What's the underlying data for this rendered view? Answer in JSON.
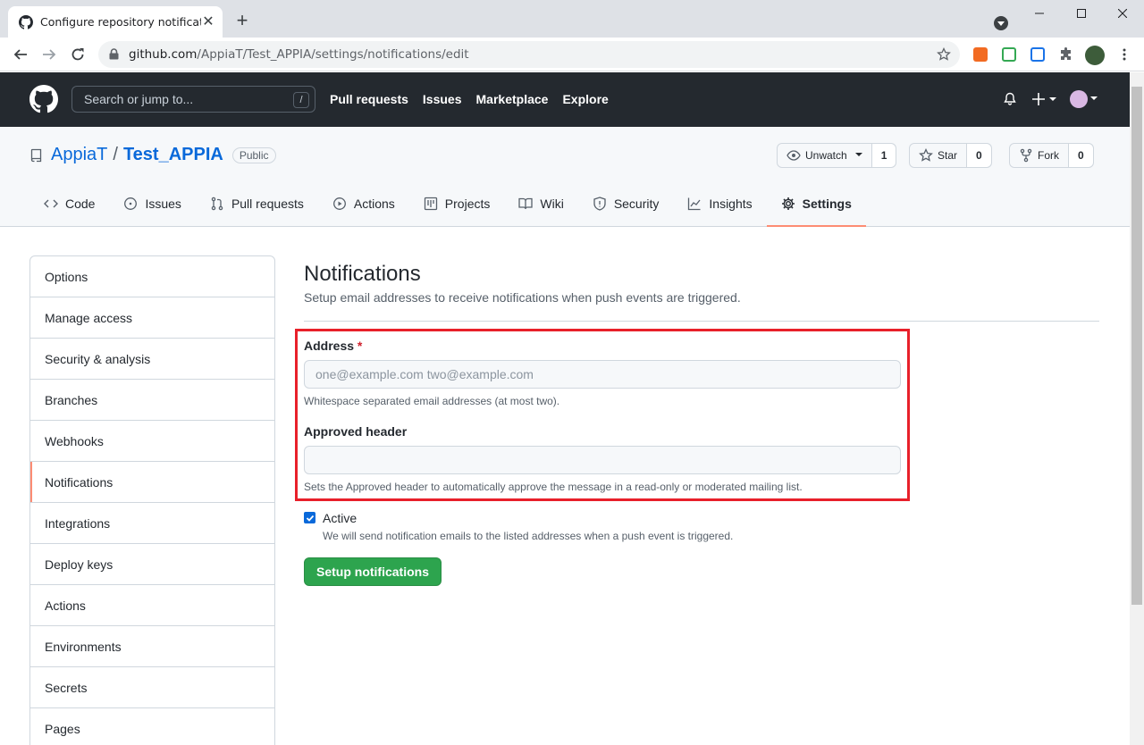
{
  "browser": {
    "tab_title": "Configure repository notification",
    "url_host": "github.com",
    "url_path": "/AppiaT/Test_APPIA/settings/notifications/edit"
  },
  "header": {
    "search_placeholder": "Search or jump to...",
    "search_shortcut": "/",
    "nav": [
      "Pull requests",
      "Issues",
      "Marketplace",
      "Explore"
    ]
  },
  "repo": {
    "owner": "AppiaT",
    "separator": "/",
    "name": "Test_APPIA",
    "visibility": "Public",
    "watch_label": "Unwatch",
    "watch_count": "1",
    "star_label": "Star",
    "star_count": "0",
    "fork_label": "Fork",
    "fork_count": "0",
    "tabs": [
      "Code",
      "Issues",
      "Pull requests",
      "Actions",
      "Projects",
      "Wiki",
      "Security",
      "Insights",
      "Settings"
    ],
    "active_tab": "Settings"
  },
  "sidebar": {
    "items": [
      "Options",
      "Manage access",
      "Security & analysis",
      "Branches",
      "Webhooks",
      "Notifications",
      "Integrations",
      "Deploy keys",
      "Actions",
      "Environments",
      "Secrets",
      "Pages"
    ],
    "active": "Notifications"
  },
  "main": {
    "title": "Notifications",
    "subtitle": "Setup email addresses to receive notifications when push events are triggered.",
    "address_label": "Address",
    "required_mark": "*",
    "address_placeholder": "one@example.com two@example.com",
    "address_note": "Whitespace separated email addresses (at most two).",
    "approved_label": "Approved header",
    "approved_value": "",
    "approved_note": "Sets the Approved header to automatically approve the message in a read-only or moderated mailing list.",
    "active_label": "Active",
    "active_checked": true,
    "active_note": "We will send notification emails to the listed addresses when a push event is triggered.",
    "submit_label": "Setup notifications"
  },
  "colors": {
    "accent_tab": "#fd8c73",
    "link": "#0969da",
    "primary_button": "#2da44e",
    "highlight_box": "#e8202a"
  }
}
